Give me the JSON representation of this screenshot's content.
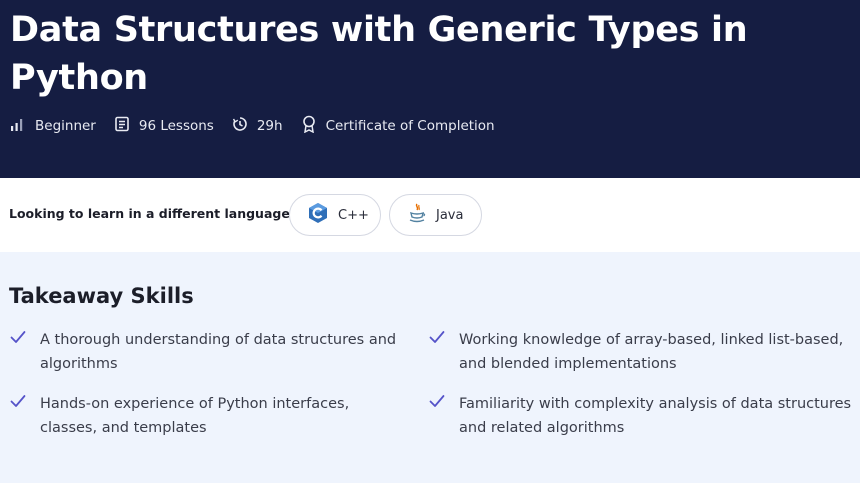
{
  "course": {
    "title": "Data Structures with Generic Types in Python",
    "meta": {
      "level": "Beginner",
      "lessons": "96 Lessons",
      "duration": "29h",
      "certificate": "Certificate of Completion"
    }
  },
  "languages": {
    "prompt": "Looking to learn in a different language?",
    "options": [
      {
        "label": "C++",
        "icon": "cpp-logo-icon"
      },
      {
        "label": "Java",
        "icon": "java-logo-icon"
      }
    ]
  },
  "takeaways": {
    "heading": "Takeaway Skills",
    "items": [
      "A thorough understanding of data structures and algorithms",
      "Working knowledge of array-based, linked list-based, and blended implementations",
      "Hands-on experience of Python interfaces, classes, and templates",
      "Familiarity with complexity analysis of data structures and related algorithms"
    ]
  },
  "colors": {
    "hero_bg": "#151d42",
    "skills_bg": "#eff4fd",
    "check": "#5553c9"
  }
}
